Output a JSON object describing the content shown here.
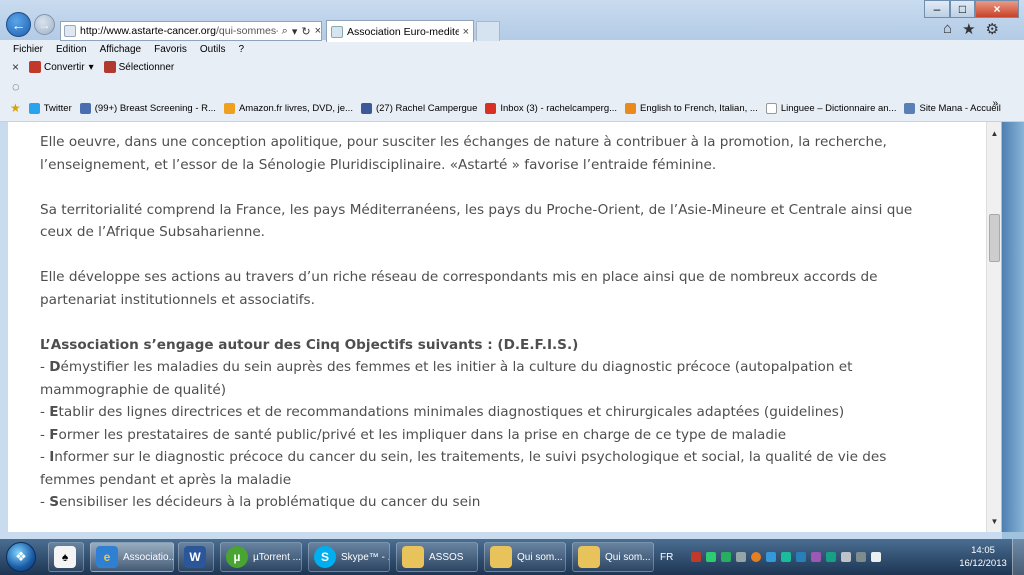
{
  "browser": {
    "url_host": "http://www.astarte-cancer.org",
    "url_path": "/qui-sommes-nous/",
    "tab_title": "Association Euro-mediterra...",
    "menu": [
      "Fichier",
      "Edition",
      "Affichage",
      "Favoris",
      "Outils",
      "?"
    ],
    "commands": {
      "convert": "Convertir",
      "select": "Sélectionner"
    },
    "favorites": [
      "Twitter",
      "(99+) Breast Screening - R...",
      "Amazon.fr  livres, DVD, je...",
      "(27) Rachel Campergue",
      "Inbox (3) - rachelcamperg...",
      "English to French, Italian, ...",
      "Linguee – Dictionnaire an...",
      "Site Mana - Accueil"
    ],
    "fav_overflow": "»"
  },
  "content": {
    "para1": "Elle oeuvre, dans une conception apolitique, pour susciter les échanges de nature à contribuer à la promotion, la recherche, l’enseignement, et l’essor de la Sénologie Pluridisciplinaire. «Astarté » favorise l’entraide féminine.",
    "para2": "Sa territorialité comprend la France, les pays Méditerranéens, les pays du Proche-Orient, de l’Asie-Mineure et Centrale ainsi que ceux de l’Afrique Subsaharienne.",
    "para3": "Elle développe ses actions au travers d’un riche réseau de correspondants mis en place ainsi que de nombreux accords de partenariat institutionnels et associatifs.",
    "objectives_title": "L’Association s’engage autour des Cinq Objectifs suivants : (D.E.F.I.S.)",
    "objectives": [
      {
        "prefix": "- ",
        "letter": "D",
        "rest": "émystifier les maladies du sein auprès des femmes et les initier à la culture du diagnostic précoce (autopalpation et mammographie de qualité)"
      },
      {
        "prefix": "- ",
        "letter": "E",
        "rest": "tablir des lignes directrices et de recommandations minimales diagnostiques et chirurgicales adaptées (guidelines)"
      },
      {
        "prefix": "- ",
        "letter": "F",
        "rest": "ormer les prestataires de santé public/privé et les impliquer dans la prise en charge de ce type de maladie"
      },
      {
        "prefix": "- ",
        "letter": "I",
        "rest": "nformer sur le diagnostic précoce du cancer du sein, les traitements, le suivi psychologique et social, la qualité de vie des femmes pendant et après la maladie"
      },
      {
        "prefix": "- ",
        "letter": "S",
        "rest": "ensibiliser les décideurs à la problématique du cancer du sein"
      }
    ]
  },
  "taskbar": {
    "buttons": [
      "Associatio...",
      "",
      "µTorrent ...",
      "Skype™ - ...",
      "ASSOS",
      "Qui som...",
      "Qui som..."
    ],
    "language": "FR",
    "time": "14:05",
    "date": "16/12/2013"
  }
}
